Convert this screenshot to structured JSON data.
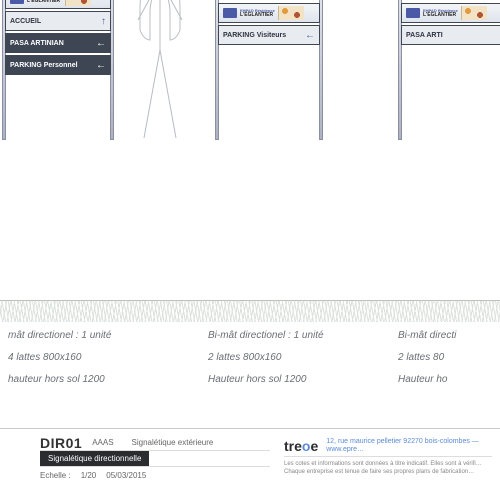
{
  "header": {
    "line1": "EHPAD Résidence",
    "line2": "L'ÉGLANTIER"
  },
  "signs": {
    "s1": {
      "slats": [
        {
          "label": "ACCUEIL",
          "arrow": "↑",
          "dark": false
        },
        {
          "label": "PASA ARTINIAN",
          "arrow": "←",
          "dark": true
        },
        {
          "label": "PARKING Personnel",
          "arrow": "←",
          "dark": true
        }
      ]
    },
    "s2": {
      "slats": [
        {
          "label": "PARKING Visiteurs",
          "arrow": "←",
          "dark": false
        }
      ]
    },
    "s3": {
      "slats": [
        {
          "label": "PASA ARTI",
          "arrow": "",
          "dark": false
        }
      ]
    }
  },
  "captions": {
    "c1": {
      "title": "mât directionel : 1 unité",
      "l1": "4 lattes 800x160",
      "l2": "hauteur hors sol 1200"
    },
    "c2": {
      "title": "Bi-mât directionel : 1 unité",
      "l1": "2 lattes 800x160",
      "l2": "Hauteur hors sol 1200"
    },
    "c3": {
      "title": "Bi-mât directi",
      "l1": "2 lattes 80",
      "l2": "Hauteur ho"
    }
  },
  "titleblock": {
    "code": "DIR01",
    "client": "AAAS",
    "project": "Signalétique extérieure",
    "blacklabel": "Signalétique directionnelle",
    "scale_label": "Echelle :",
    "scale_value": "1/20",
    "date": "05/03/2015",
    "brand": "tre",
    "brand_o": "o",
    "brand2": "e",
    "address": "12, rue maurice pelletier 92270 bois-colombes — www.epre…",
    "fine1": "Les cotes et informations sont données à titre indicatif. Elles sont à vérifi…",
    "fine2": "Chaque entreprise est tenue de faire ses propres plans de fabrication…"
  }
}
